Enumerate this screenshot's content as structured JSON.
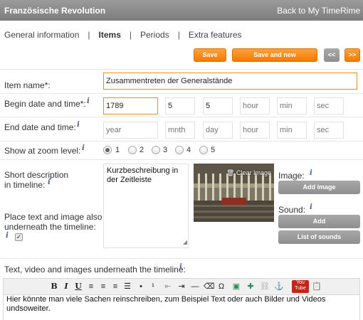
{
  "header": {
    "app_title": "Französische Revolution",
    "back_link": "Back to My TimeRime"
  },
  "tabs": [
    {
      "label": "General information"
    },
    {
      "label": "Items"
    },
    {
      "label": "Periods"
    },
    {
      "label": "Extra features"
    }
  ],
  "tab_separator": "|",
  "actions": {
    "save": "Save",
    "save_and_new": "Save and new",
    "prev": "<<",
    "next": ">>"
  },
  "form": {
    "item_name": {
      "label": "Item name*:",
      "value": "Zusammentreten der Generalstände"
    },
    "begin": {
      "label": "Begin date and time*:",
      "year": "1789",
      "month": "5",
      "day": "5",
      "hour_placeholder": "hour",
      "min_placeholder": "min",
      "sec_placeholder": "sec"
    },
    "end": {
      "label": "End date and time:",
      "year_placeholder": "year",
      "month_placeholder": "mnth",
      "day_placeholder": "day",
      "hour_placeholder": "hour",
      "min_placeholder": "min",
      "sec_placeholder": "sec"
    },
    "zoom": {
      "label": "Show at zoom level:",
      "options": [
        "1",
        "2",
        "3",
        "4",
        "5"
      ],
      "selected": "1"
    },
    "short_description": {
      "label_line1": "Short description",
      "label_line2": "in timeline:",
      "value": "Kurzbeschreibung in der Zeitleiste"
    },
    "place_below": {
      "label_line1": "Place text and image also",
      "label_line2": "underneath the timeline:",
      "checked": true
    },
    "image": {
      "clear_label": "Clear Image",
      "label": "Image:",
      "add_button": "Add image"
    },
    "sound": {
      "label": "Sound:",
      "add_button": "Add",
      "list_button": "List of sounds"
    },
    "rich_text": {
      "label": "Text, video and images underneath the timeline:",
      "value": "Hier könnte man viele Sachen reinschreiben, zum Beispiel Text oder auch Bilder und Videos undsoweiter."
    }
  },
  "info_glyph": "i",
  "toolbar": {
    "bold": "B",
    "italic": "I",
    "underline": "U",
    "youtube_line1": "You",
    "youtube_line2": "Tube"
  },
  "colors": {
    "accent_orange": "#f58a12",
    "header_gray": "#8c8c8c",
    "button_gray": "#9a9a9a",
    "info_blue": "#4a5a9a"
  }
}
